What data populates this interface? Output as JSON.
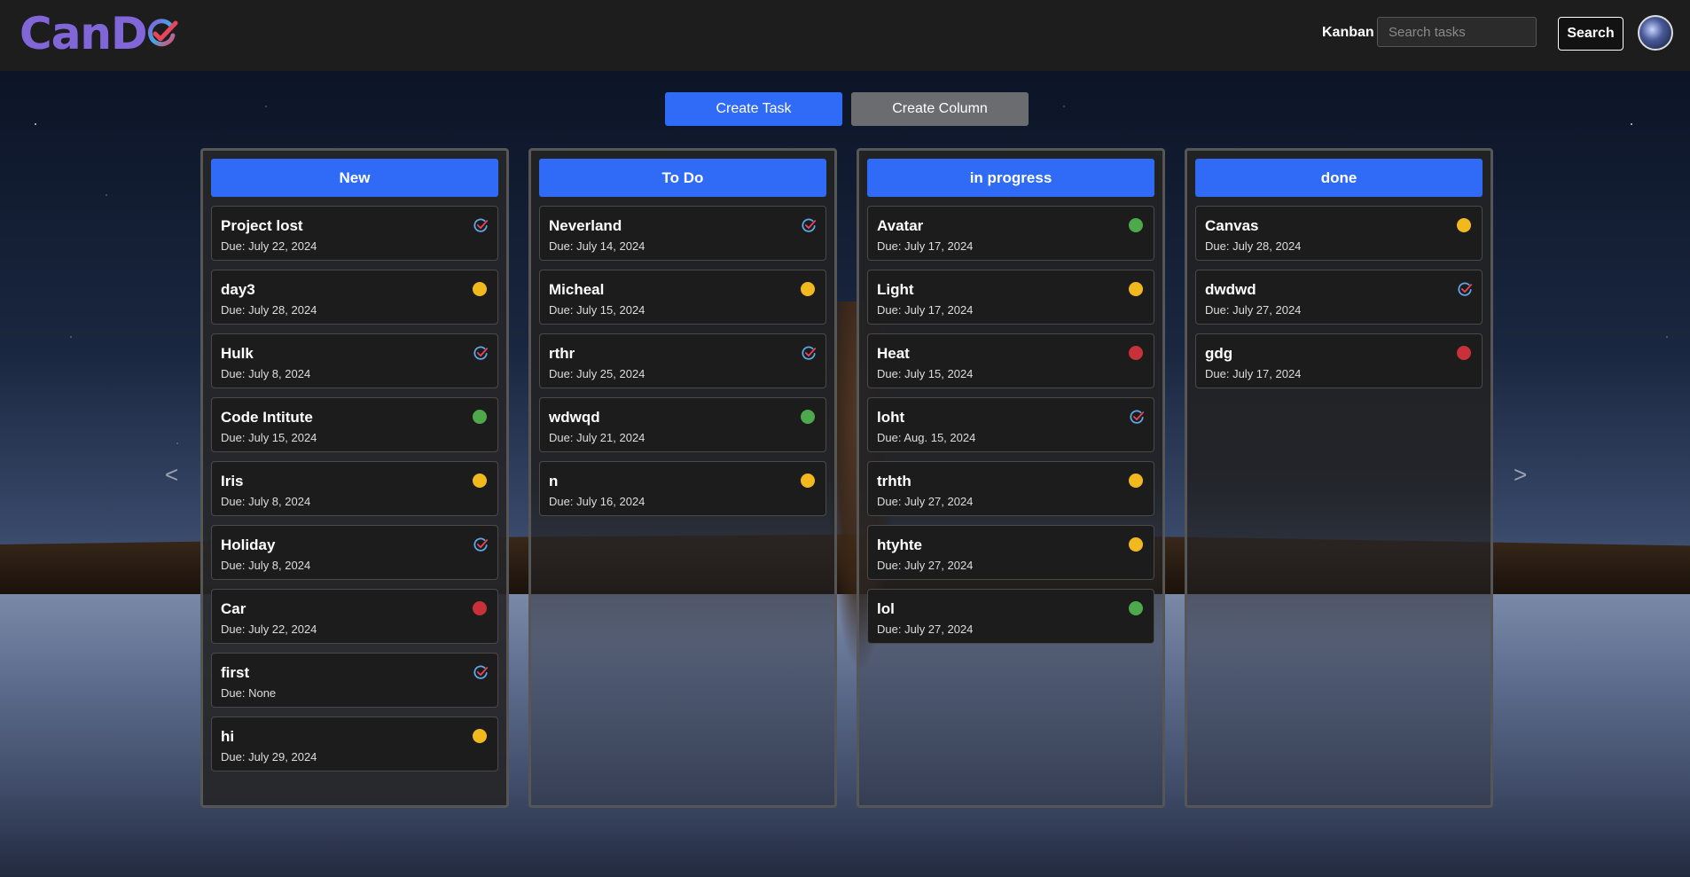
{
  "app": {
    "logo_text": "CanD"
  },
  "header": {
    "nav_label": "Kanban",
    "search_placeholder": "Search tasks",
    "search_button": "Search"
  },
  "actions": {
    "create_task": "Create Task",
    "create_column": "Create Column"
  },
  "carousel": {
    "prev": "<",
    "next": ">"
  },
  "status_colors": {
    "yellow": "#f2b91f",
    "green": "#4ea84c",
    "red": "#c8303a",
    "check": "#5aa8e6",
    "accent": "#2f6bf7"
  },
  "columns": [
    {
      "title": "New",
      "cards": [
        {
          "title": "Project lost",
          "due": "Due: July 22, 2024",
          "status": "check"
        },
        {
          "title": "day3",
          "due": "Due: July 28, 2024",
          "status": "yellow"
        },
        {
          "title": "Hulk",
          "due": "Due: July 8, 2024",
          "status": "check"
        },
        {
          "title": "Code Intitute",
          "due": "Due: July 15, 2024",
          "status": "green"
        },
        {
          "title": "Iris",
          "due": "Due: July 8, 2024",
          "status": "yellow"
        },
        {
          "title": "Holiday",
          "due": "Due: July 8, 2024",
          "status": "check"
        },
        {
          "title": "Car",
          "due": "Due: July 22, 2024",
          "status": "red"
        },
        {
          "title": "first",
          "due": "Due: None",
          "status": "check"
        },
        {
          "title": "hi",
          "due": "Due: July 29, 2024",
          "status": "yellow"
        }
      ]
    },
    {
      "title": "To Do",
      "cards": [
        {
          "title": "Neverland",
          "due": "Due: July 14, 2024",
          "status": "check"
        },
        {
          "title": "Micheal",
          "due": "Due: July 15, 2024",
          "status": "yellow"
        },
        {
          "title": "rthr",
          "due": "Due: July 25, 2024",
          "status": "check"
        },
        {
          "title": "wdwqd",
          "due": "Due: July 21, 2024",
          "status": "green"
        },
        {
          "title": "n",
          "due": "Due: July 16, 2024",
          "status": "yellow"
        }
      ]
    },
    {
      "title": "in progress",
      "cards": [
        {
          "title": "Avatar",
          "due": "Due: July 17, 2024",
          "status": "green"
        },
        {
          "title": "Light",
          "due": "Due: July 17, 2024",
          "status": "yellow"
        },
        {
          "title": "Heat",
          "due": "Due: July 15, 2024",
          "status": "red"
        },
        {
          "title": "loht",
          "due": "Due: Aug. 15, 2024",
          "status": "check"
        },
        {
          "title": "trhth",
          "due": "Due: July 27, 2024",
          "status": "yellow"
        },
        {
          "title": "htyhte",
          "due": "Due: July 27, 2024",
          "status": "yellow"
        },
        {
          "title": "lol",
          "due": "Due: July 27, 2024",
          "status": "green"
        }
      ]
    },
    {
      "title": "done",
      "cards": [
        {
          "title": "Canvas",
          "due": "Due: July 28, 2024",
          "status": "yellow"
        },
        {
          "title": "dwdwd",
          "due": "Due: July 27, 2024",
          "status": "check"
        },
        {
          "title": "gdg",
          "due": "Due: July 17, 2024",
          "status": "red"
        }
      ]
    }
  ]
}
